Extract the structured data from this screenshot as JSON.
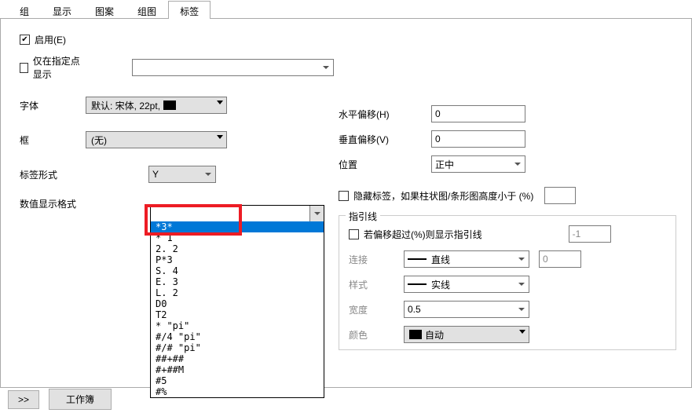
{
  "tabs": [
    "组",
    "显示",
    "图案",
    "组图",
    "标签"
  ],
  "activeTab": 4,
  "enable": {
    "label": "启用(E)",
    "checked": true
  },
  "showAtPoints": {
    "label": "仅在指定点显示",
    "checked": false
  },
  "font": {
    "label": "字体",
    "value": "默认: 宋体, 22pt,"
  },
  "frame": {
    "label": "框",
    "value": "(无)"
  },
  "labelForm": {
    "label": "标签形式",
    "value": "Y"
  },
  "numFormat": {
    "label": "数值显示格式",
    "value": "",
    "options": [
      "*3*",
      "* 1",
      "2. 2",
      "P*3",
      "S. 4",
      "E. 3",
      "L. 2",
      "D0",
      "T2",
      "* \"pi\"",
      "#/4 \"pi\"",
      "#/# \"pi\"",
      "##+##",
      "#+##M",
      "#5",
      "#%"
    ]
  },
  "offset": {
    "h": {
      "label": "水平偏移(H)",
      "value": "0"
    },
    "v": {
      "label": "垂直偏移(V)",
      "value": "0"
    },
    "pos": {
      "label": "位置",
      "value": "正中"
    }
  },
  "hideLabel": {
    "label": "隐藏标签，如果柱状图/条形图高度小于 (%)",
    "checked": false,
    "value": ""
  },
  "leader": {
    "title": "指引线",
    "cond": {
      "label": "若偏移超过(%)则显示指引线",
      "checked": false,
      "value": "-1"
    },
    "connect": {
      "label": "连接",
      "value": "直线",
      "num": "0"
    },
    "style": {
      "label": "样式",
      "value": "实线"
    },
    "width": {
      "label": "宽度",
      "value": "0.5"
    },
    "color": {
      "label": "颜色",
      "value": "自动"
    }
  },
  "bottom": {
    "next": ">>",
    "workbook": "工作簿"
  }
}
